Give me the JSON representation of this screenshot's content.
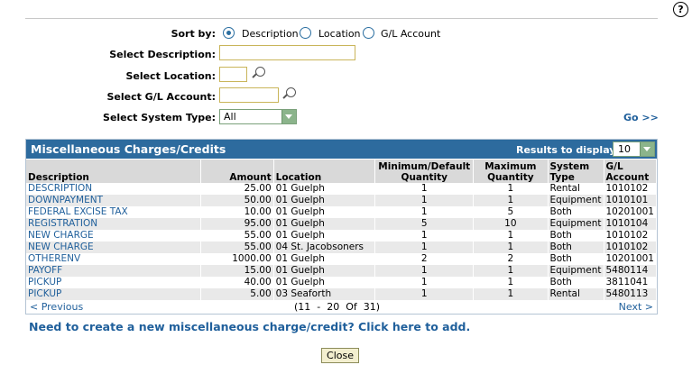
{
  "help": {
    "glyph": "?"
  },
  "form": {
    "sort_label": "Sort by:",
    "sort_options": [
      "Description",
      "Location",
      "G/L Account"
    ],
    "sort_selected": "Description",
    "desc_label": "Select Description:",
    "desc_value": "",
    "loc_label": "Select Location:",
    "loc_value": "",
    "gl_label": "Select G/L Account:",
    "gl_value": "",
    "systype_label": "Select System Type:",
    "systype_value": "All",
    "go_label": "Go >>"
  },
  "panel": {
    "title": "Miscellaneous Charges/Credits",
    "results_label": "Results to display:",
    "results_value": "10",
    "columns": {
      "description": "Description",
      "amount": "Amount",
      "location": "Location",
      "min_qty_1": "Minimum/Default",
      "min_qty_2": "Quantity",
      "max_qty_1": "Maximum",
      "max_qty_2": "Quantity",
      "sys_1": "System",
      "sys_2": "Type",
      "gl_1": "G/L",
      "gl_2": "Account"
    },
    "rows": [
      {
        "description": "DESCRIPTION",
        "amount": "25.00",
        "location": "01 Guelph",
        "min": "1",
        "max": "1",
        "system": "Rental",
        "gl": "1010102"
      },
      {
        "description": "DOWNPAYMENT",
        "amount": "50.00",
        "location": "01 Guelph",
        "min": "1",
        "max": "1",
        "system": "Equipment",
        "gl": "1010101"
      },
      {
        "description": "FEDERAL EXCISE TAX",
        "amount": "10.00",
        "location": "01 Guelph",
        "min": "1",
        "max": "5",
        "system": "Both",
        "gl": "10201001"
      },
      {
        "description": "REGISTRATION",
        "amount": "95.00",
        "location": "01 Guelph",
        "min": "5",
        "max": "10",
        "system": "Equipment",
        "gl": "1010104"
      },
      {
        "description": "NEW CHARGE",
        "amount": "55.00",
        "location": "01 Guelph",
        "min": "1",
        "max": "1",
        "system": "Both",
        "gl": "1010102"
      },
      {
        "description": "NEW CHARGE",
        "amount": "55.00",
        "location": "04 St. Jacobsoners",
        "min": "1",
        "max": "1",
        "system": "Both",
        "gl": "1010102"
      },
      {
        "description": "OTHERENV",
        "amount": "1000.00",
        "location": "01 Guelph",
        "min": "2",
        "max": "2",
        "system": "Both",
        "gl": "10201001"
      },
      {
        "description": "PAYOFF",
        "amount": "15.00",
        "location": "01 Guelph",
        "min": "1",
        "max": "1",
        "system": "Equipment",
        "gl": "5480114"
      },
      {
        "description": "PICKUP",
        "amount": "40.00",
        "location": "01 Guelph",
        "min": "1",
        "max": "1",
        "system": "Both",
        "gl": "3811041"
      },
      {
        "description": "PICKUP",
        "amount": "5.00",
        "location": "03 Seaforth",
        "min": "1",
        "max": "1",
        "system": "Rental",
        "gl": "5480113"
      }
    ],
    "prev_label": "< Previous",
    "range_label": "(11  -  20  Of  31)",
    "next_label": "Next >"
  },
  "add_link": "Need to create a new miscellaneous charge/credit? Click here to add.",
  "close_label": "Close"
}
